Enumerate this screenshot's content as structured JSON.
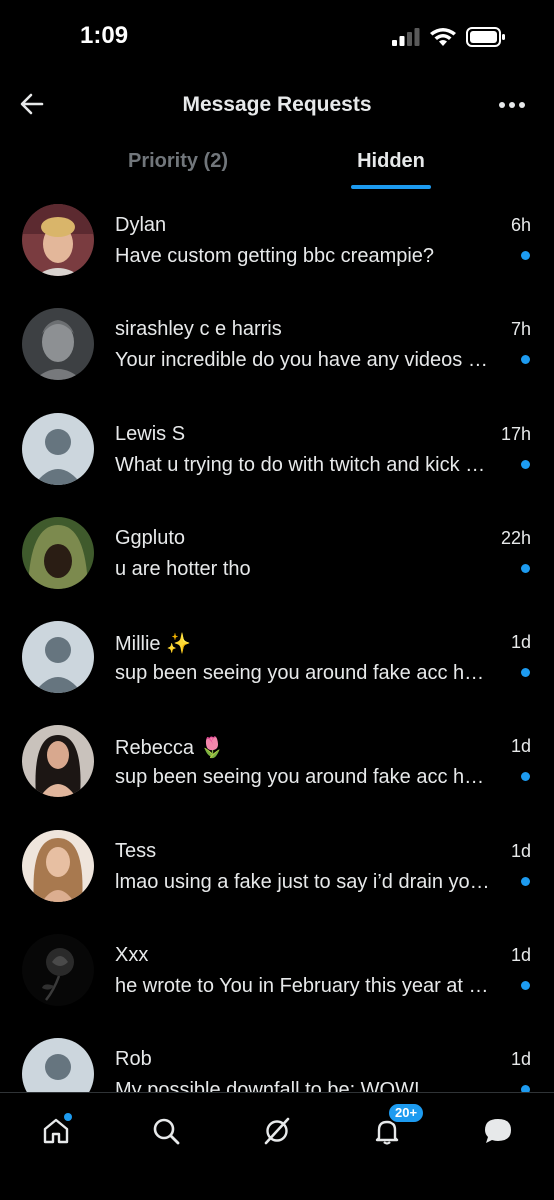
{
  "status_bar": {
    "time": "1:09"
  },
  "header": {
    "title": "Message Requests"
  },
  "tabs": [
    {
      "label": "Priority (2)",
      "active": false
    },
    {
      "label": "Hidden",
      "active": true
    }
  ],
  "conversations": [
    {
      "name": "Dylan",
      "time": "6h",
      "preview": "Have custom getting bbc creampie?",
      "unread": true
    },
    {
      "name": "sirashley c e harris",
      "time": "7h",
      "preview": "Your incredible do you have any videos of you",
      "unread": true
    },
    {
      "name": "Lewis S",
      "time": "17h",
      "preview": "What u trying to do with twitch and kick streams",
      "unread": true
    },
    {
      "name": "Ggpluto",
      "time": "22h",
      "preview": "u are hotter tho",
      "unread": true
    },
    {
      "name": "Millie ✨",
      "time": "1d",
      "preview": "sup been seeing you around fake acc here lol",
      "unread": true
    },
    {
      "name": "Rebecca 🌷",
      "time": "1d",
      "preview": "sup been seeing you around fake acc here lol",
      "unread": true
    },
    {
      "name": "Tess",
      "time": "1d",
      "preview": "lmao using a fake just to say i’d drain you fr",
      "unread": true
    },
    {
      "name": "Xxx",
      "time": "1d",
      "preview": "he wrote to You in February this year at night",
      "unread": true
    },
    {
      "name": "Rob",
      "time": "1d",
      "preview": "My possible downfall to be: WOW!",
      "unread": true
    }
  ],
  "bottom_nav": {
    "items": [
      "home-icon",
      "search-icon",
      "grok-icon",
      "notifications-icon",
      "messages-icon"
    ],
    "notifications_badge": "20+"
  },
  "colors": {
    "accent": "#1d9bf0",
    "background": "#000000",
    "text": "#e7e9ea",
    "muted": "#71767b"
  }
}
